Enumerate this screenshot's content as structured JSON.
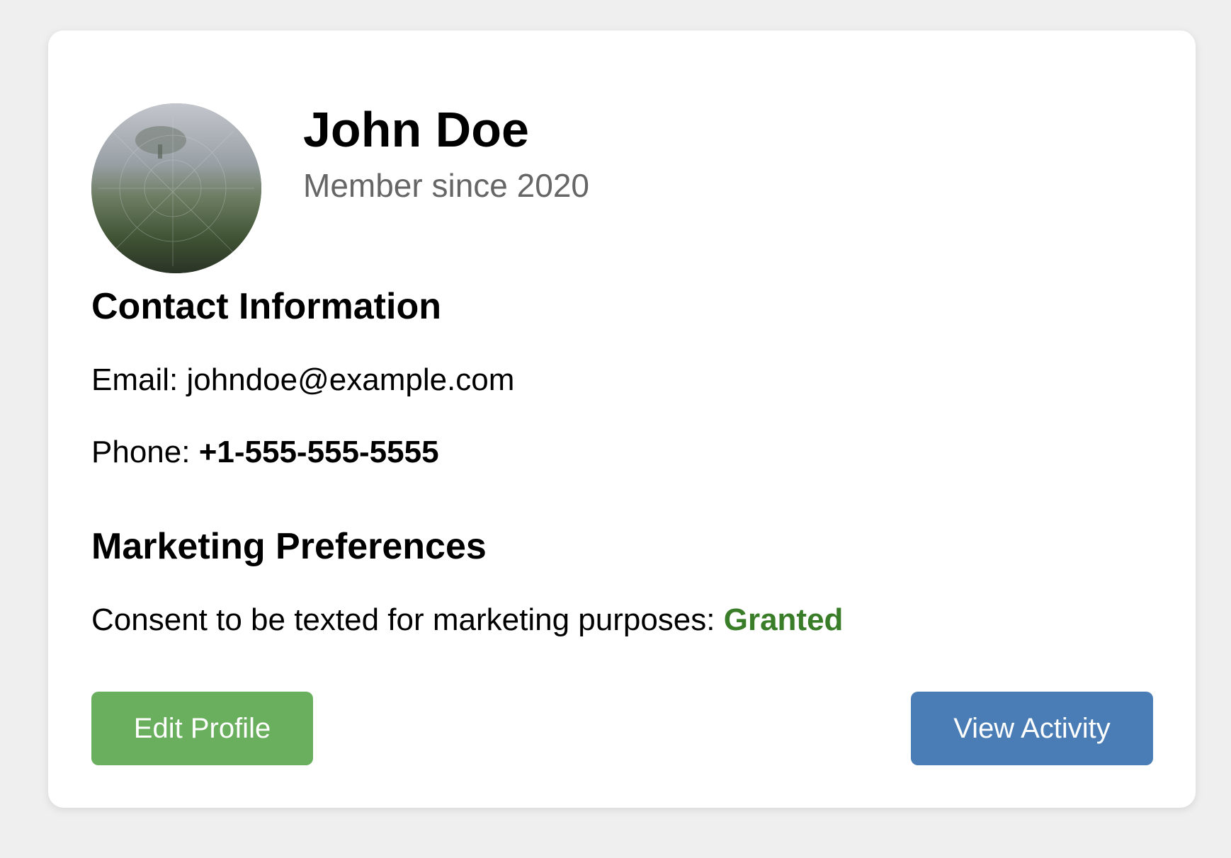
{
  "profile": {
    "name": "John Doe",
    "member_since": "Member since 2020"
  },
  "contact": {
    "heading": "Contact Information",
    "email_label": "Email:",
    "email_value": "johndoe@example.com",
    "phone_label": "Phone:",
    "phone_value": "+1-555-555-5555"
  },
  "marketing": {
    "heading": "Marketing Preferences",
    "consent_label": "Consent to be texted for marketing purposes:",
    "consent_value": "Granted"
  },
  "actions": {
    "edit_label": "Edit Profile",
    "activity_label": "View Activity"
  },
  "colors": {
    "page_background": "#efefef",
    "card_background": "#ffffff",
    "granted_text": "#3a7d28",
    "edit_button": "#6aaf5e",
    "activity_button": "#4a7db5",
    "muted_text": "#666666"
  }
}
